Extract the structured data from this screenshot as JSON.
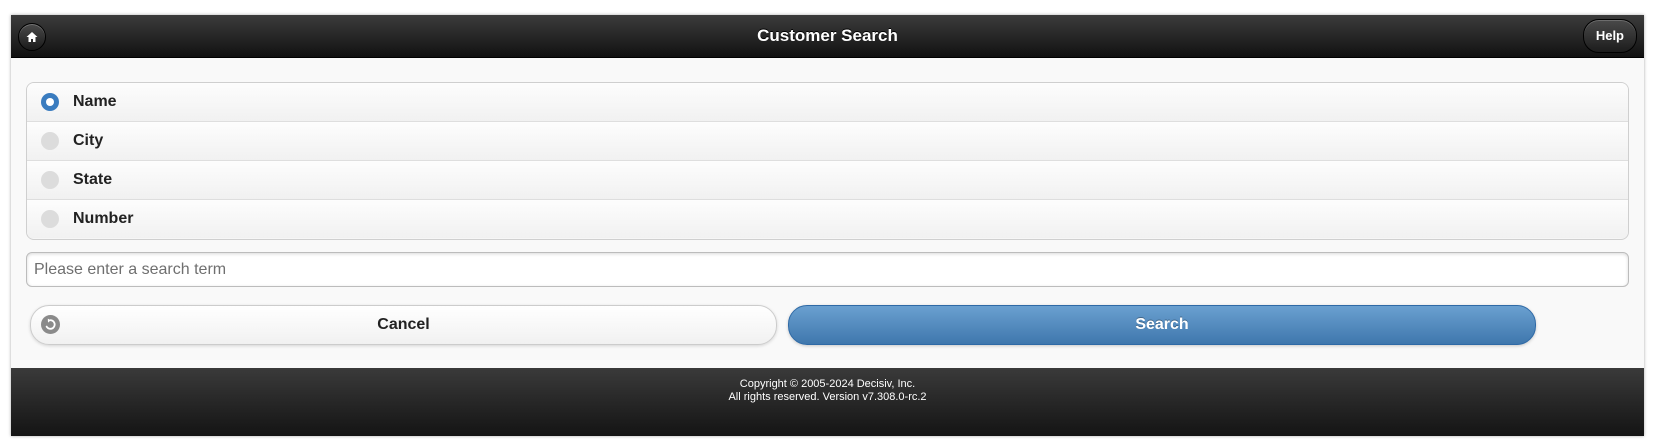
{
  "header": {
    "title": "Customer Search",
    "home_icon": "home-icon",
    "help_label": "Help"
  },
  "search_options": {
    "selected": "Name",
    "items": [
      {
        "label": "Name",
        "checked": true
      },
      {
        "label": "City",
        "checked": false
      },
      {
        "label": "State",
        "checked": false
      },
      {
        "label": "Number",
        "checked": false
      }
    ]
  },
  "search": {
    "value": "",
    "placeholder": "Please enter a search term"
  },
  "actions": {
    "cancel_label": "Cancel",
    "cancel_icon": "undo-icon",
    "search_label": "Search"
  },
  "footer": {
    "copyright": "Copyright © 2005-2024 Decisiv, Inc.",
    "rights": "All rights reserved. Version v7.308.0-rc.2"
  },
  "colors": {
    "header_bg": "#1e1e1e",
    "accent": "#3a7cbf",
    "search_button": "#4f87bd"
  }
}
